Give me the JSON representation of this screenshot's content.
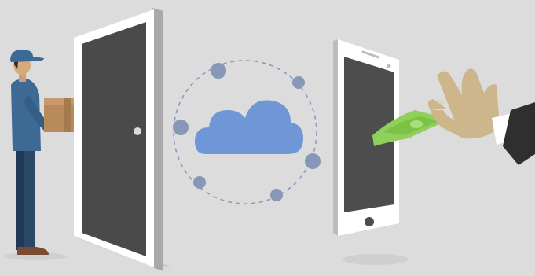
{
  "scene": {
    "background_color": "#dcdcdc",
    "elements": [
      {
        "name": "delivery-person",
        "icon": "delivery-person-icon"
      },
      {
        "name": "package",
        "icon": "box-icon"
      },
      {
        "name": "door",
        "icon": "door-icon"
      },
      {
        "name": "cloud-network",
        "icon": "cloud-icon",
        "orbit_nodes": 6
      },
      {
        "name": "smartphone",
        "icon": "smartphone-icon"
      },
      {
        "name": "money-bill",
        "icon": "banknote-icon"
      },
      {
        "name": "hand-with-cash",
        "icon": "hand-icon"
      }
    ],
    "colors": {
      "door_frame": "#ffffff",
      "door_panel": "#4a4a4a",
      "cloud": "#6f96d6",
      "node": "#8897b8",
      "orbit": "#8a9ac0",
      "phone_screen": "#4d4d4d",
      "cash": "#8fd05a",
      "uniform": "#3a5f86",
      "skin": "#d7aa7c",
      "suit": "#2f2f2f"
    }
  }
}
